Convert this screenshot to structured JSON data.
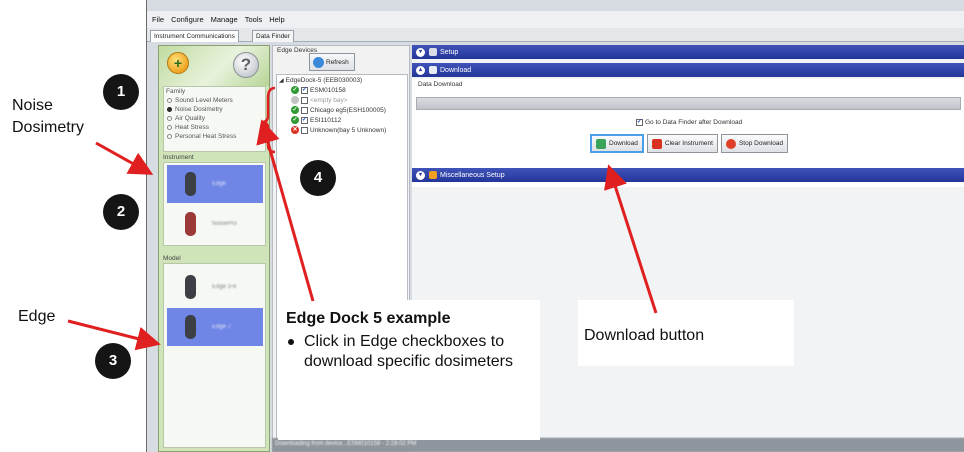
{
  "menu": [
    "File",
    "Configure",
    "Manage",
    "Tools",
    "Help"
  ],
  "tabs": [
    "Instrument Communications",
    "Data Finder"
  ],
  "family": {
    "title": "Family",
    "options": [
      "Sound Level Meters",
      "Noise Dosimetry",
      "Air Quality",
      "Heat Stress",
      "Personal Heat Stress"
    ],
    "selected": "Noise Dosimetry"
  },
  "instrument": {
    "title": "Instrument",
    "items": [
      "Edge",
      "NoisePro"
    ]
  },
  "model": {
    "title": "Model",
    "items": [
      "Edge 3-6",
      "Edge 7"
    ]
  },
  "edge_devices": {
    "title": "Edge Devices",
    "refresh_label": "Refresh",
    "root": "EdgeDock-5 (EEB030003)",
    "bays": [
      {
        "label": "ESM010158",
        "status": "ok",
        "checked": true
      },
      {
        "label": "<empty bay>",
        "status": "none",
        "checked": false
      },
      {
        "label": "Chicago eg5(ESH100005)",
        "status": "ok",
        "checked": false
      },
      {
        "label": "ESI110112",
        "status": "ok",
        "checked": true
      },
      {
        "label": "Unknown(bay 5 Unknown)",
        "status": "error",
        "checked": false
      }
    ]
  },
  "sections": {
    "setup": "Setup",
    "download": "Download",
    "misc": "Miscellaneous Setup"
  },
  "download": {
    "label": "Data Download",
    "goto_label": "Go to Data Finder after Download",
    "goto_checked": true,
    "buttons": [
      "Download",
      "Clear Instrument",
      "Stop Download"
    ]
  },
  "status_text": "Downloading from device...ESM010158 - 2:28:02 PM",
  "annotations": {
    "step1": "1",
    "step2": "2",
    "step3": "3",
    "step4": "4",
    "noise_label_line1": "Noise",
    "noise_label_line2": "Dosimetry",
    "edge_label": "Edge",
    "callout_title": "Edge Dock 5 example",
    "callout_bullet": "Click in Edge checkboxes to download specific dosimeters",
    "download_button_label": "Download button"
  },
  "colors": {
    "section_bar": "#2e40a8",
    "selected_item": "#6f86e6",
    "left_panel": "#cfe4b8",
    "arrow": "#e02020"
  }
}
